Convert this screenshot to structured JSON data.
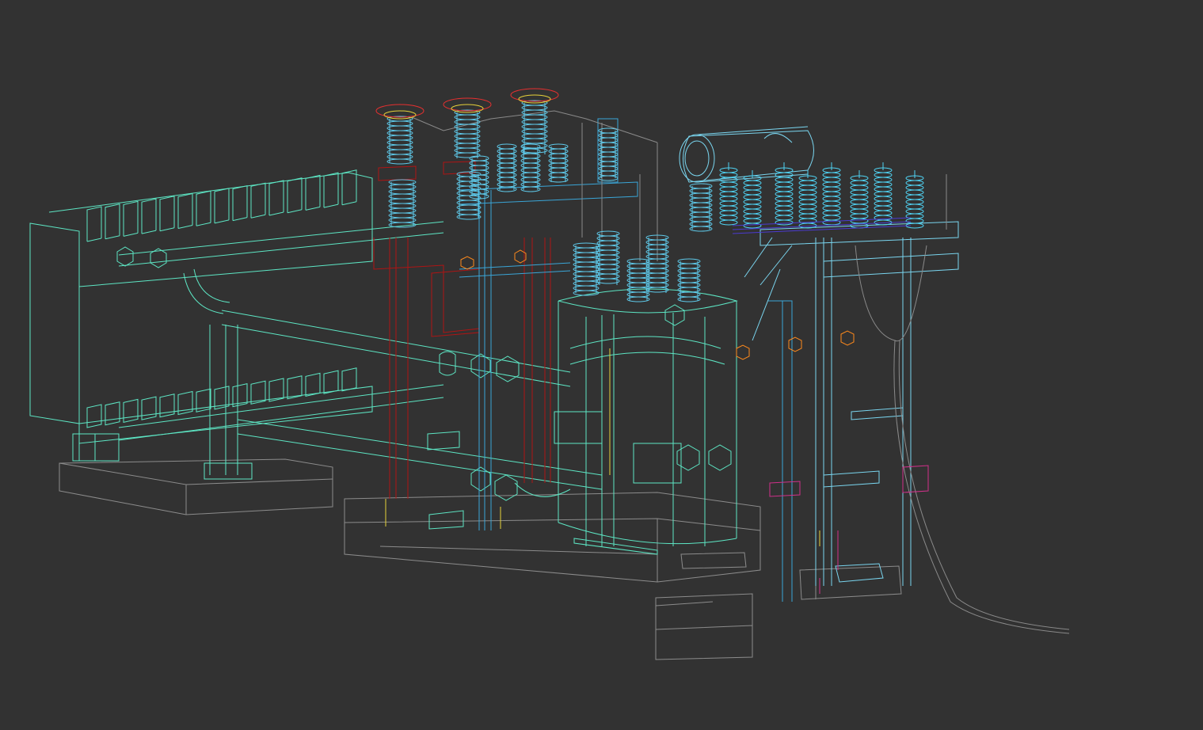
{
  "viewport": {
    "background": "#323232",
    "mode": "wireframe",
    "model": "power-transformer"
  },
  "colors": {
    "radiator": "#5de6c4",
    "bushing": "#5ec8e8",
    "tank": "#5de6c4",
    "conservator": "#7ad6f0",
    "support_red": "#b01414",
    "support_blue": "#3aa6d8",
    "flange_orange": "#ff8a1c",
    "top_flange": "#e83030",
    "cable": "#8a8a8a",
    "foundation": "#8c8c8c",
    "clamp_magenta": "#d0308a",
    "busbar_purple": "#4b3ad0",
    "arrester_cyan": "#4fd2f2",
    "accent_yellow": "#e6d23a"
  }
}
